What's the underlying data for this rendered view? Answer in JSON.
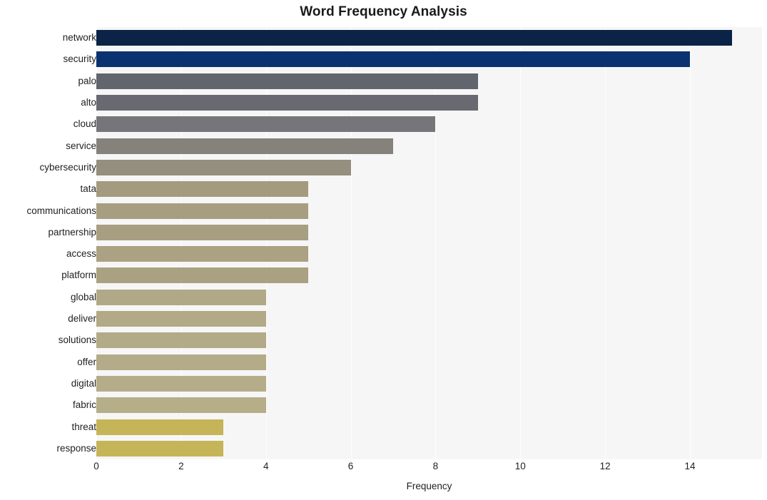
{
  "chart_data": {
    "type": "bar",
    "orientation": "horizontal",
    "title": "Word Frequency Analysis",
    "xlabel": "Frequency",
    "ylabel": "",
    "categories": [
      "network",
      "security",
      "palo",
      "alto",
      "cloud",
      "service",
      "cybersecurity",
      "tata",
      "communications",
      "partnership",
      "access",
      "platform",
      "global",
      "deliver",
      "solutions",
      "offer",
      "digital",
      "fabric",
      "threat",
      "response"
    ],
    "values": [
      15,
      14,
      9,
      9,
      8,
      7,
      6,
      5,
      5,
      5,
      5,
      5,
      4,
      4,
      4,
      4,
      4,
      4,
      3,
      3
    ],
    "xlim": [
      0,
      15.7
    ],
    "xticks": [
      0,
      2,
      4,
      6,
      8,
      10,
      12,
      14
    ],
    "xtick_labels": [
      "0",
      "2",
      "4",
      "6",
      "8",
      "10",
      "12",
      "14"
    ],
    "grid": true,
    "grid_axis": "x",
    "legend": "none",
    "bar_colors": [
      "#0a2347",
      "#0b3270",
      "#63656e",
      "#686a72",
      "#76767a",
      "#85827c",
      "#948f7e",
      "#a39a80",
      "#a79e81",
      "#a89f82",
      "#ab a1 83",
      "#aaa183",
      "#b1a887",
      "#b2a987",
      "#b3aa88",
      "#b4ab88",
      "#b5ac89",
      "#b6ad89",
      "#c5b558",
      "#c5b558"
    ],
    "colors": {
      "plot_background": "#f6f6f6",
      "figure_background": "#ffffff",
      "gridline": "#ffffff",
      "text": "#1f1f1f",
      "title": "#1a1a1a"
    }
  }
}
